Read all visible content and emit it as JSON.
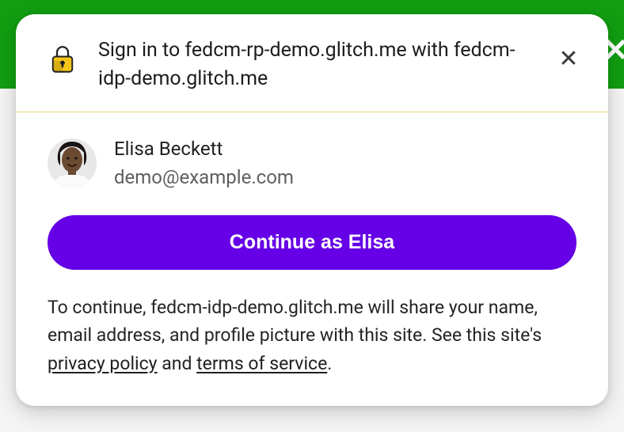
{
  "header": {
    "title_prefix": "Sign in to ",
    "rp_domain": "fedcm-rp-demo.glitch.me",
    "title_with": " with ",
    "idp_domain": "fedcm-idp-demo.glitch.me",
    "close_glyph": "✕"
  },
  "account": {
    "name": "Elisa Beckett",
    "email": "demo@example.com"
  },
  "actions": {
    "continue_label": "Continue as Elisa"
  },
  "disclosure": {
    "intro": "To continue, ",
    "idp_domain": "fedcm-idp-demo.glitch.me",
    "share_clause": " will share your name, email address, and profile picture with this site. See this site's ",
    "privacy_label": "privacy policy",
    "and_text": " and ",
    "terms_label": "terms of service",
    "period": "."
  },
  "colors": {
    "banner": "#119e11",
    "primary": "#6600e6"
  }
}
